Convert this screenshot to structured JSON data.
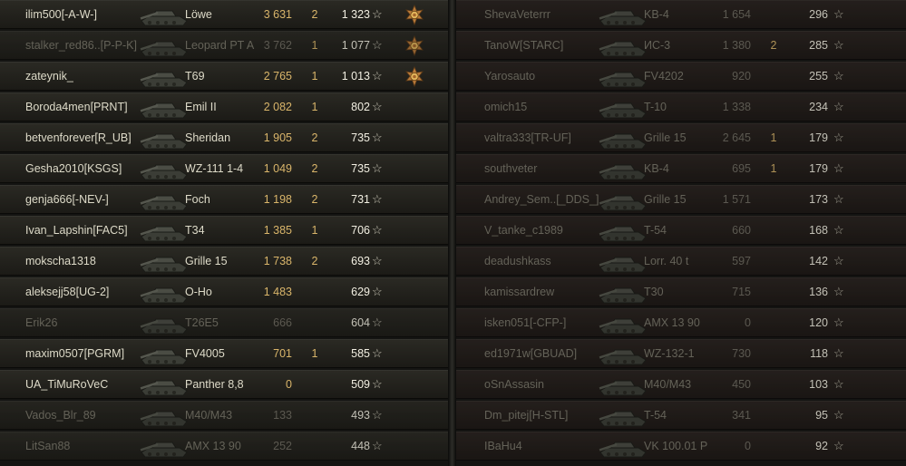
{
  "left_team": [
    {
      "player": "ilim500[-A-W-]",
      "tank": "Löwe",
      "damage": "3 631",
      "kills": "2",
      "xp": "1 323",
      "medal": true,
      "dead": false
    },
    {
      "player": "stalker_red86..[P-P-K]",
      "tank": "Leopard PT A",
      "damage": "3 762",
      "kills": "1",
      "xp": "1 077",
      "medal": true,
      "dead": true
    },
    {
      "player": "zateynik_",
      "tank": "T69",
      "damage": "2 765",
      "kills": "1",
      "xp": "1 013",
      "medal": true,
      "dead": false
    },
    {
      "player": "Boroda4men[PRNT]",
      "tank": "Emil II",
      "damage": "2 082",
      "kills": "1",
      "xp": "802",
      "medal": false,
      "dead": false
    },
    {
      "player": "betvenforever[R_UB]",
      "tank": "Sheridan",
      "damage": "1 905",
      "kills": "2",
      "xp": "735",
      "medal": false,
      "dead": false
    },
    {
      "player": "Gesha2010[KSGS]",
      "tank": "WZ-111 1-4",
      "damage": "1 049",
      "kills": "2",
      "xp": "735",
      "medal": false,
      "dead": false
    },
    {
      "player": "genja666[-NEV-]",
      "tank": "Foch",
      "damage": "1 198",
      "kills": "2",
      "xp": "731",
      "medal": false,
      "dead": false
    },
    {
      "player": "Ivan_Lapshin[FAC5]",
      "tank": "T34",
      "damage": "1 385",
      "kills": "1",
      "xp": "706",
      "medal": false,
      "dead": false
    },
    {
      "player": "mokscha1318",
      "tank": "Grille 15",
      "damage": "1 738",
      "kills": "2",
      "xp": "693",
      "medal": false,
      "dead": false
    },
    {
      "player": "aleksejj58[UG-2]",
      "tank": "O-Ho",
      "damage": "1 483",
      "kills": "",
      "xp": "629",
      "medal": false,
      "dead": false
    },
    {
      "player": "Erik26",
      "tank": "T26E5",
      "damage": "666",
      "kills": "",
      "xp": "604",
      "medal": false,
      "dead": true
    },
    {
      "player": "maxim0507[PGRM]",
      "tank": "FV4005",
      "damage": "701",
      "kills": "1",
      "xp": "585",
      "medal": false,
      "dead": false
    },
    {
      "player": "UA_TiMuRoVeC",
      "tank": "Panther 8,8",
      "damage": "0",
      "kills": "",
      "xp": "509",
      "medal": false,
      "dead": false
    },
    {
      "player": "Vados_Blr_89",
      "tank": "M40/M43",
      "damage": "133",
      "kills": "",
      "xp": "493",
      "medal": false,
      "dead": true
    },
    {
      "player": "LitSan88",
      "tank": "AMX 13 90",
      "damage": "252",
      "kills": "",
      "xp": "448",
      "medal": false,
      "dead": true
    }
  ],
  "right_team": [
    {
      "player": "ShevaVeterrr",
      "tank": "KB-4",
      "damage": "1 654",
      "kills": "",
      "xp": "296",
      "medal": false,
      "dead": true
    },
    {
      "player": "TanoW[STARC]",
      "tank": "ИС-3",
      "damage": "1 380",
      "kills": "2",
      "xp": "285",
      "medal": false,
      "dead": true
    },
    {
      "player": "Yarosauto",
      "tank": "FV4202",
      "damage": "920",
      "kills": "",
      "xp": "255",
      "medal": false,
      "dead": true
    },
    {
      "player": "omich15",
      "tank": "T-10",
      "damage": "1 338",
      "kills": "",
      "xp": "234",
      "medal": false,
      "dead": true
    },
    {
      "player": "valtra333[TR-UF]",
      "tank": "Grille 15",
      "damage": "2 645",
      "kills": "1",
      "xp": "179",
      "medal": false,
      "dead": true
    },
    {
      "player": "southveter",
      "tank": "KB-4",
      "damage": "695",
      "kills": "1",
      "xp": "179",
      "medal": false,
      "dead": true
    },
    {
      "player": "Andrey_Sem..[_DDS_]",
      "tank": "Grille 15",
      "damage": "1 571",
      "kills": "",
      "xp": "173",
      "medal": false,
      "dead": true
    },
    {
      "player": "V_tanke_c1989",
      "tank": "T-54",
      "damage": "660",
      "kills": "",
      "xp": "168",
      "medal": false,
      "dead": true
    },
    {
      "player": "deadushkass",
      "tank": "Lorr. 40 t",
      "damage": "597",
      "kills": "",
      "xp": "142",
      "medal": false,
      "dead": true
    },
    {
      "player": "kamissardrew",
      "tank": "T30",
      "damage": "715",
      "kills": "",
      "xp": "136",
      "medal": false,
      "dead": true
    },
    {
      "player": "isken051[-CFP-]",
      "tank": "AMX 13 90",
      "damage": "0",
      "kills": "",
      "xp": "120",
      "medal": false,
      "dead": true
    },
    {
      "player": "ed1971w[GBUAD]",
      "tank": "WZ-132-1",
      "damage": "730",
      "kills": "",
      "xp": "118",
      "medal": false,
      "dead": true
    },
    {
      "player": "oSnAssasin",
      "tank": "M40/M43",
      "damage": "450",
      "kills": "",
      "xp": "103",
      "medal": false,
      "dead": true
    },
    {
      "player": "Dm_pitej[H-STL]",
      "tank": "T-54",
      "damage": "341",
      "kills": "",
      "xp": "95",
      "medal": false,
      "dead": true
    },
    {
      "player": "IBaHu4",
      "tank": "VK 100.01 P",
      "damage": "0",
      "kills": "",
      "xp": "92",
      "medal": false,
      "dead": true
    }
  ],
  "icons": {
    "xp": "star-icon",
    "tank": "tank-silhouette-icon",
    "medal": "medal-icon"
  },
  "colors": {
    "damage": "#d9b56a",
    "xp": "#f2efe2",
    "player": "#dedbc9",
    "dead_text": "#7b786c"
  }
}
